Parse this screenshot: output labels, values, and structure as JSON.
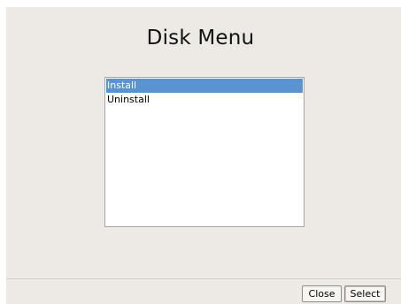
{
  "dialog": {
    "title": "Disk Menu"
  },
  "list": {
    "items": [
      {
        "label": "Install",
        "selected": true
      },
      {
        "label": "Uninstall",
        "selected": false
      }
    ]
  },
  "buttons": {
    "close_label": "Close",
    "select_label": "Select"
  },
  "colors": {
    "background": "#edeae5",
    "selection": "#5b93d1"
  }
}
